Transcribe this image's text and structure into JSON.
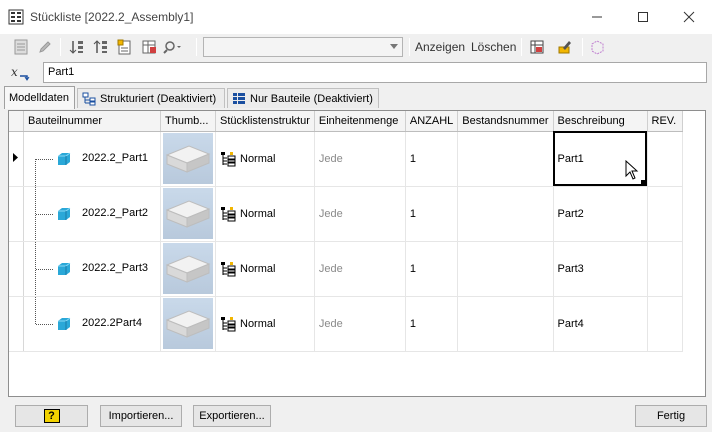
{
  "window": {
    "title": "Stückliste [2022.2_Assembly1]",
    "controls": {
      "minimize": "minimize-icon",
      "maximize": "maximize-icon",
      "close": "close-icon"
    }
  },
  "toolbar": {
    "combo_value": "",
    "show_label": "Anzeigen",
    "delete_label": "Löschen"
  },
  "formula_bar": {
    "value": "Part1"
  },
  "tabs": [
    {
      "label": "Modelldaten",
      "active": true
    },
    {
      "label": "Strukturiert (Deaktiviert)",
      "active": false
    },
    {
      "label": "Nur Bauteile (Deaktiviert)",
      "active": false
    }
  ],
  "columns": [
    "Bauteilnummer",
    "Thumb...",
    "Stücklistenstruktur",
    "Einheitenmenge",
    "ANZAHL",
    "Bestandsnummer",
    "Beschreibung",
    "REV."
  ],
  "rows": [
    {
      "part_number": "2022.2_Part1",
      "structure": "Normal",
      "unit_qty": "Jede",
      "qty": "1",
      "stock": "",
      "description": "Part1",
      "rev": ""
    },
    {
      "part_number": "2022.2_Part2",
      "structure": "Normal",
      "unit_qty": "Jede",
      "qty": "1",
      "stock": "",
      "description": "Part2",
      "rev": ""
    },
    {
      "part_number": "2022.2_Part3",
      "structure": "Normal",
      "unit_qty": "Jede",
      "qty": "1",
      "stock": "",
      "description": "Part3",
      "rev": ""
    },
    {
      "part_number": "2022.2Part4",
      "structure": "Normal",
      "unit_qty": "Jede",
      "qty": "1",
      "stock": "",
      "description": "Part4",
      "rev": ""
    }
  ],
  "footer": {
    "help_label": "?",
    "import_label": "Importieren...",
    "export_label": "Exportieren...",
    "done_label": "Fertig"
  },
  "colors": {
    "part_icon": "#2aa8d8",
    "thumb_bg": "#c3d4e6",
    "accent": "#1a4fa0"
  }
}
